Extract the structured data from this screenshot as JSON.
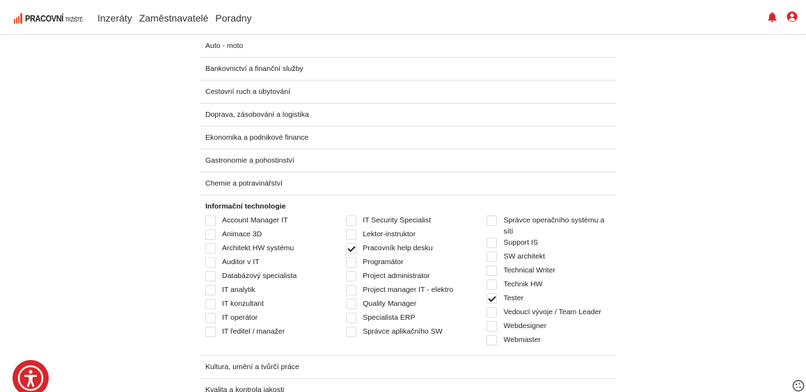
{
  "header": {
    "logo_text_main": "PRACOVNÍ",
    "logo_text_sub": "TRŽIŠTĚ",
    "nav": [
      "Inzeráty",
      "Zaměstnavatelé",
      "Poradny"
    ],
    "icons": [
      "bell-icon",
      "user-circle-icon"
    ],
    "accent_color": "#d8262b"
  },
  "categories_before": [
    "Auto - moto",
    "Bankovnictví a finanční služby",
    "Cestovní ruch a ubytování",
    "Doprava, zásobování a logistika",
    "Ekonomika a podnikové finance",
    "Gastronomie a pohostinství",
    "Chemie a potravinářství"
  ],
  "open_category": {
    "title": "Informační technologie",
    "columns": [
      [
        {
          "label": "Account Manager IT",
          "checked": false
        },
        {
          "label": "Animace 3D",
          "checked": false
        },
        {
          "label": "Architekt HW systému",
          "checked": false
        },
        {
          "label": "Auditor v IT",
          "checked": false
        },
        {
          "label": "Databázový specialista",
          "checked": false
        },
        {
          "label": "IT analytik",
          "checked": false
        },
        {
          "label": "IT konzultant",
          "checked": false
        },
        {
          "label": "IT operátor",
          "checked": false
        },
        {
          "label": "IT ředitel / manažer",
          "checked": false
        }
      ],
      [
        {
          "label": "IT Security Specialist",
          "checked": false
        },
        {
          "label": "Lektor-instruktor",
          "checked": false
        },
        {
          "label": "Pracovník help desku",
          "checked": true
        },
        {
          "label": "Programátor",
          "checked": false
        },
        {
          "label": "Project administrator",
          "checked": false
        },
        {
          "label": "Project manager IT - elektro",
          "checked": false
        },
        {
          "label": "Quality Manager",
          "checked": false
        },
        {
          "label": "Specialista ERP",
          "checked": false
        },
        {
          "label": "Správce aplikačního SW",
          "checked": false
        }
      ],
      [
        {
          "label": "Správce operačního systému a sítí",
          "checked": false
        },
        {
          "label": "Support IS",
          "checked": false
        },
        {
          "label": "SW architekt",
          "checked": false
        },
        {
          "label": "Technical Writer",
          "checked": false
        },
        {
          "label": "Technik HW",
          "checked": false
        },
        {
          "label": "Tester",
          "checked": true
        },
        {
          "label": "Vedoucí vývoje / Team Leader",
          "checked": false
        },
        {
          "label": "Webdesigner",
          "checked": false
        },
        {
          "label": "Webmaster",
          "checked": false
        }
      ]
    ]
  },
  "categories_after": [
    "Kultura, umění a tvůrčí práce",
    "Kvalita a kontrola jakosti"
  ],
  "widgets": {
    "accessibility_icon": "accessibility-icon",
    "cookie_icon": "cookie-icon"
  }
}
